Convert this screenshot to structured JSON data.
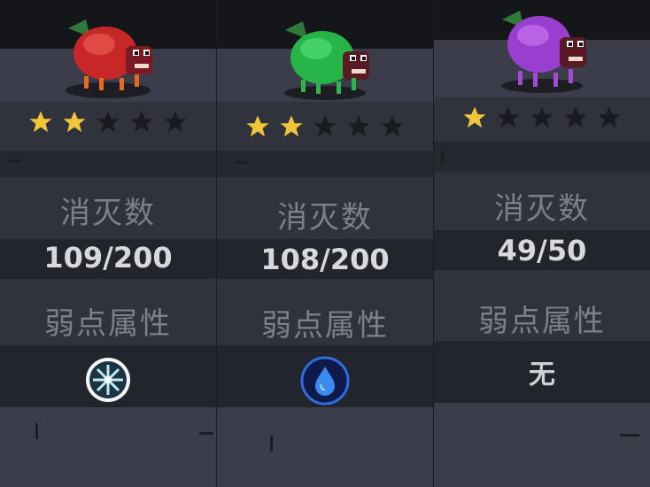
{
  "labels": {
    "kills": "消灭数",
    "weakness": "弱点属性"
  },
  "cards": [
    {
      "monster": "red-shell-crab",
      "shell_color": "#c8272a",
      "stars_filled": 2,
      "stars_total": 5,
      "kills": "109/200",
      "weakness_icon": "ice-snowflake-icon",
      "weakness_text": ""
    },
    {
      "monster": "green-shell-crab",
      "shell_color": "#27b54a",
      "stars_filled": 2,
      "stars_total": 5,
      "kills": "108/200",
      "weakness_icon": "water-drop-icon",
      "weakness_text": ""
    },
    {
      "monster": "purple-shell-crab",
      "shell_color": "#9a3ed0",
      "stars_filled": 1,
      "stars_total": 5,
      "kills": "49/50",
      "weakness_icon": "",
      "weakness_text": "无"
    }
  ]
}
